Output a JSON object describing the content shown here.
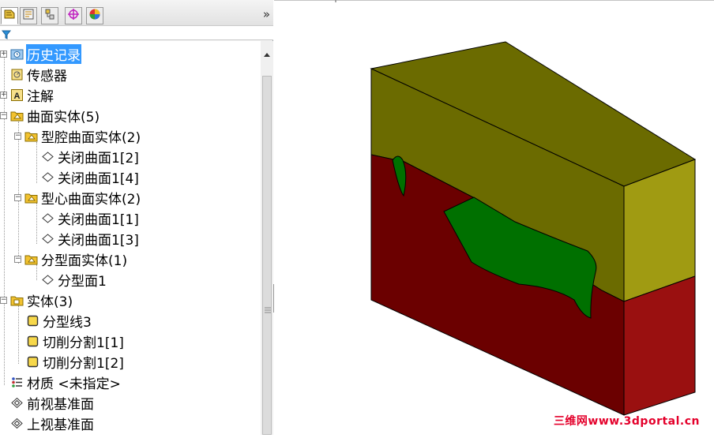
{
  "panel": {
    "tabs": [
      {
        "name": "feature-manager-tab",
        "icon": "feature-tree-icon"
      },
      {
        "name": "property-manager-tab",
        "icon": "property-sheet-icon"
      },
      {
        "name": "configuration-manager-tab",
        "icon": "configuration-icon"
      },
      {
        "name": "dimxpert-tab",
        "icon": "crosshair-icon"
      },
      {
        "name": "display-manager-tab",
        "icon": "color-wheel-icon"
      }
    ],
    "collapse_label": "»"
  },
  "tree": {
    "items": [
      {
        "label": "历史记录",
        "icon": "history-folder-icon",
        "selected": true
      },
      {
        "label": "传感器",
        "icon": "sensor-icon"
      },
      {
        "label": "注解",
        "icon": "annotation-icon"
      },
      {
        "label": "曲面实体(5)",
        "icon": "surface-bodies-folder-icon"
      },
      {
        "label": "型腔曲面实体(2)",
        "icon": "surface-bodies-folder-icon"
      },
      {
        "label": "关闭曲面1[2]",
        "icon": "surface-body-icon"
      },
      {
        "label": "关闭曲面1[4]",
        "icon": "surface-body-icon"
      },
      {
        "label": "型心曲面实体(2)",
        "icon": "surface-bodies-folder-icon"
      },
      {
        "label": "关闭曲面1[1]",
        "icon": "surface-body-icon"
      },
      {
        "label": "关闭曲面1[3]",
        "icon": "surface-body-icon"
      },
      {
        "label": "分型面实体(1)",
        "icon": "surface-bodies-folder-icon"
      },
      {
        "label": "分型面1",
        "icon": "surface-body-icon"
      },
      {
        "label": "实体(3)",
        "icon": "solid-bodies-folder-icon"
      },
      {
        "label": "分型线3",
        "icon": "solid-body-icon"
      },
      {
        "label": "切削分割1[1]",
        "icon": "solid-body-icon"
      },
      {
        "label": "切削分割1[2]",
        "icon": "solid-body-icon"
      },
      {
        "label": "材质 <未指定>",
        "icon": "material-icon"
      },
      {
        "label": "前视基准面",
        "icon": "plane-icon"
      },
      {
        "label": "上视基准面",
        "icon": "plane-icon"
      }
    ]
  },
  "model": {
    "colors": {
      "cavity_top": "#6b6b00",
      "cavity_side": "#a09b12",
      "core_front": "#6b0000",
      "core_side": "#9a1010",
      "parting_surface": "#007000",
      "edge": "#000000"
    }
  },
  "watermark": "三维网www.3dportal.cn"
}
